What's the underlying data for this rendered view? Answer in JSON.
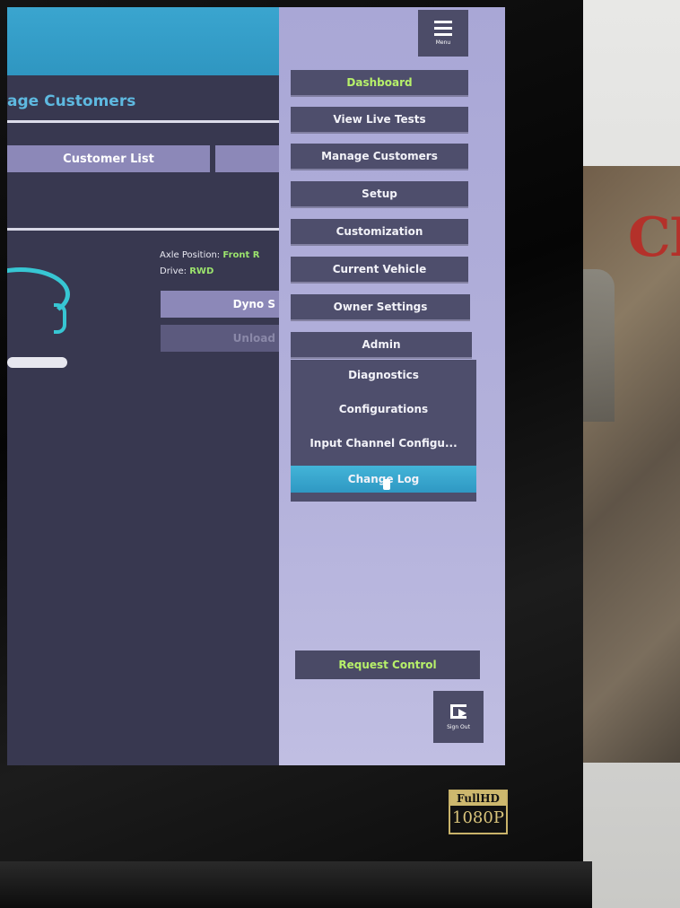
{
  "app": {
    "page_title": "age Customers",
    "tabs": [
      "Customer List",
      ""
    ],
    "vehicle_info": {
      "axle_label": "Axle Position:",
      "axle_value": "Front R",
      "drive_label": "Drive:",
      "drive_value": "RWD"
    },
    "actions": {
      "dyno": "Dyno S",
      "unload": "Unload"
    }
  },
  "drawer": {
    "menu_label": "Menu",
    "items": [
      "Dashboard",
      "View Live Tests",
      "Manage Customers",
      "Setup",
      "Customization",
      "Current Vehicle",
      "Owner Settings",
      "Admin"
    ],
    "admin_submenu": [
      "Diagnostics",
      "Configurations",
      "Input Channel Configu...",
      "Change Log"
    ],
    "request_control": "Request Control",
    "sign_out": "Sign Out"
  },
  "monitor": {
    "badge_top": "FullHD",
    "badge_bottom": "1080P"
  },
  "colors": {
    "header_blue": "#3aa5cf",
    "drawer_lavender": "#a9a7d6",
    "button_dark": "#4e4e6c",
    "accent_green": "#b7f06a",
    "highlight_cyan": "#43b4d8"
  },
  "icons": [
    "hamburger-menu-icon",
    "sign-out-icon",
    "pointer-cursor-icon"
  ]
}
